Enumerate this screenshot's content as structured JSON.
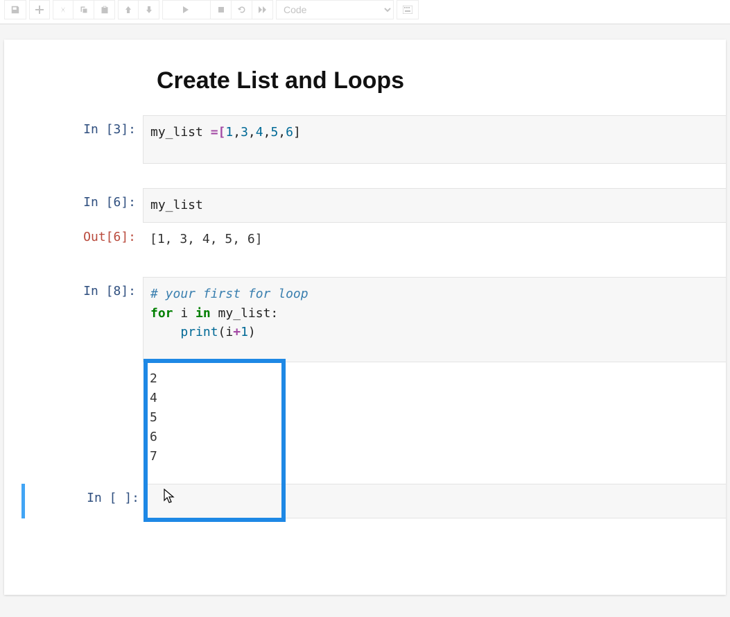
{
  "toolbar": {
    "cell_type": "Code"
  },
  "heading": "Create List and Loops",
  "cell1": {
    "prompt": "In [3]:",
    "code": {
      "var": "my_list",
      "eq": " =[",
      "n1": "1",
      "c1": ",",
      "n2": "3",
      "c2": ",",
      "n3": "4",
      "c3": ",",
      "n4": "5",
      "c4": ",",
      "n5": "6",
      "close": "]"
    }
  },
  "cell2": {
    "prompt": "In [6]:",
    "code": "my_list",
    "out_prompt": "Out[6]:",
    "output": "[1, 3, 4, 5, 6]"
  },
  "cell3": {
    "prompt": "In [8]:",
    "comment": "# your first for loop",
    "line2": {
      "for": "for",
      "i": " i ",
      "in": "in",
      "rest": " my_list:"
    },
    "line3": {
      "indent": "    ",
      "print": "print",
      "open": "(",
      "var": "i",
      "plus": "+",
      "one": "1",
      "close": ")"
    },
    "output": "2\n4\n5\n6\n7"
  },
  "cell4": {
    "prompt": "In [ ]:",
    "code": ""
  }
}
